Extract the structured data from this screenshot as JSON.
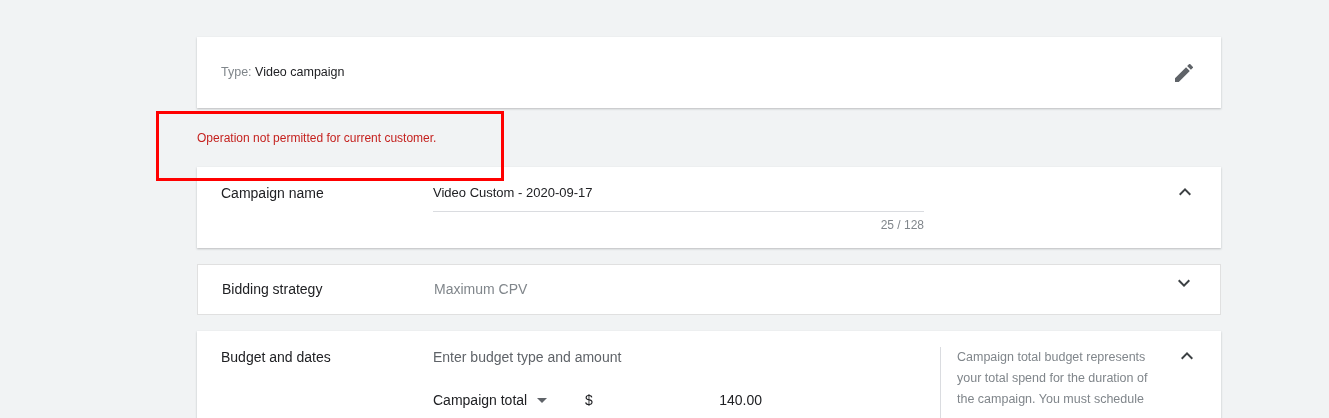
{
  "type_card": {
    "label": "Type:",
    "value": "Video campaign"
  },
  "error": {
    "message": "Operation not permitted for current customer.",
    "highlighted": true
  },
  "sections": [
    {
      "kind": "name_field",
      "title": "Campaign name",
      "expanded": true,
      "value": "Video Custom - 2020-09-17",
      "counter": "25 / 128"
    },
    {
      "kind": "summary",
      "title": "Bidding strategy",
      "expanded": false,
      "summary": "Maximum CPV"
    },
    {
      "kind": "budget",
      "title": "Budget and dates",
      "expanded": true,
      "prompt": "Enter budget type and amount",
      "budget_type": "Campaign total",
      "currency": "$",
      "amount": "140.00",
      "help": "Campaign total budget represents your total spend for the duration of the campaign. You must schedule"
    }
  ]
}
